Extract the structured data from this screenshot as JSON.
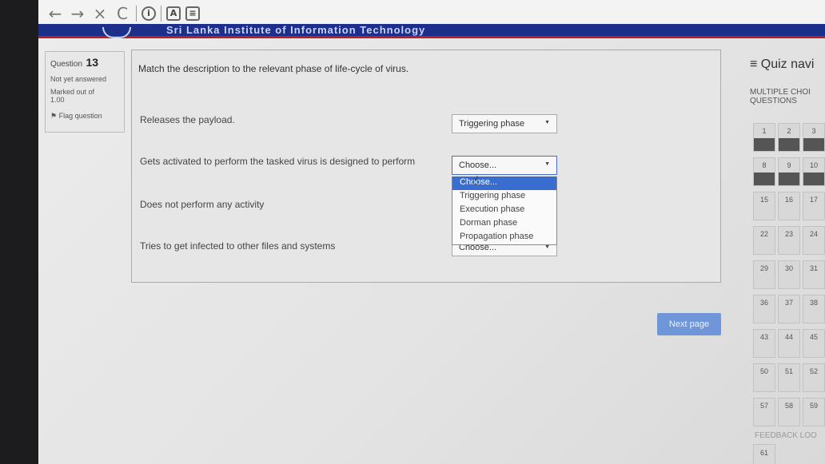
{
  "browser": {
    "back": "←",
    "forward": "→",
    "close": "×",
    "reload": "C",
    "info": "i",
    "ext_a": "A",
    "ext_b": "≡"
  },
  "site": {
    "title": "Sri Lanka Institute of Information Technology"
  },
  "question_info": {
    "label": "Question",
    "number": "13",
    "status": "Not yet answered",
    "marked": "Marked out of",
    "mark_value": "1.00",
    "flag": "Flag question"
  },
  "question": {
    "text": "Match the description to the relevant phase of life-cycle of virus.",
    "rows": [
      {
        "desc": "Releases the payload.",
        "selected": "Triggering phase"
      },
      {
        "desc": "Gets activated to perform the tasked virus is designed to perform",
        "selected": "Choose..."
      },
      {
        "desc": "Does not perform any activity",
        "selected": ""
      },
      {
        "desc": "Tries to get infected to other files and systems",
        "selected": "Choose..."
      }
    ],
    "dropdown_options": [
      "Choose...",
      "Triggering phase",
      "Execution phase",
      "Dorman phase",
      "Propagation phase"
    ]
  },
  "next_button": "Next page",
  "quiz_nav": {
    "title": "≡ Quiz navi",
    "subtitle_line1": "MULTIPLE CHOI",
    "subtitle_line2": "QUESTIONS",
    "cells": [
      {
        "n": "1",
        "answered": true
      },
      {
        "n": "2",
        "answered": true
      },
      {
        "n": "3",
        "answered": true
      },
      {
        "n": "8",
        "answered": true
      },
      {
        "n": "9",
        "answered": true
      },
      {
        "n": "10",
        "answered": true
      },
      {
        "n": "15",
        "answered": false
      },
      {
        "n": "16",
        "answered": false
      },
      {
        "n": "17",
        "answered": false
      },
      {
        "n": "22",
        "answered": false
      },
      {
        "n": "23",
        "answered": false
      },
      {
        "n": "24",
        "answered": false
      },
      {
        "n": "29",
        "answered": false
      },
      {
        "n": "30",
        "answered": false
      },
      {
        "n": "31",
        "answered": false
      },
      {
        "n": "36",
        "answered": false
      },
      {
        "n": "37",
        "answered": false
      },
      {
        "n": "38",
        "answered": false
      },
      {
        "n": "43",
        "answered": false
      },
      {
        "n": "44",
        "answered": false
      },
      {
        "n": "45",
        "answered": false
      },
      {
        "n": "50",
        "answered": false
      },
      {
        "n": "51",
        "answered": false
      },
      {
        "n": "52",
        "answered": false
      },
      {
        "n": "57",
        "answered": false
      },
      {
        "n": "58",
        "answered": false
      },
      {
        "n": "59",
        "answered": false
      }
    ],
    "feedback": "FEEDBACK LOO",
    "last_cell": "61"
  },
  "colors": {
    "header": "#1c2f8a",
    "header_border": "#b32025",
    "highlight": "#3a6dd0",
    "button": "#6f96d8"
  }
}
